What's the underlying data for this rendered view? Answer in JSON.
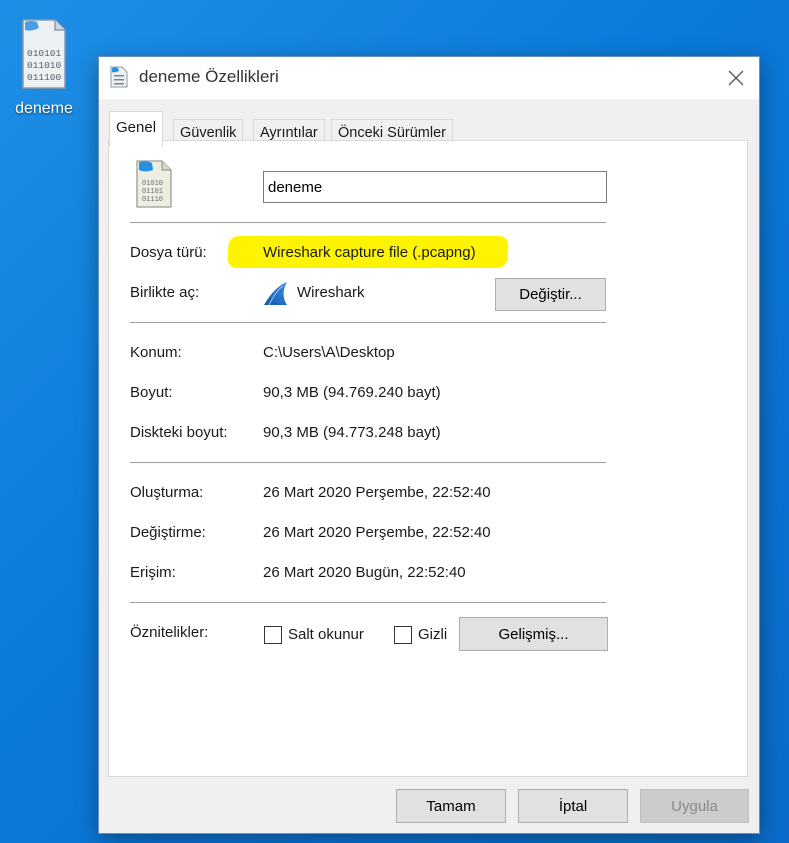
{
  "desktop": {
    "icon_label": "deneme",
    "icon_bits": [
      "010101",
      "011010",
      "011100"
    ]
  },
  "dialog": {
    "title": "deneme Özellikleri",
    "tabs": [
      {
        "label": "Genel",
        "active": true
      },
      {
        "label": "Güvenlik",
        "active": false
      },
      {
        "label": "Ayrıntılar",
        "active": false
      },
      {
        "label": "Önceki Sürümler",
        "active": false
      }
    ],
    "file_icon_bits": [
      "01010",
      "01101",
      "01110"
    ],
    "file_name": "deneme",
    "file_type_label": "Dosya türü:",
    "file_type_value": "Wireshark capture file (.pcapng)",
    "opens_with_label": "Birlikte aç:",
    "opens_with_value": "Wireshark",
    "change_button": "Değiştir...",
    "location_label": "Konum:",
    "location_value": "C:\\Users\\A\\Desktop",
    "size_label": "Boyut:",
    "size_value": "90,3 MB (94.769.240 bayt)",
    "disk_size_label": "Diskteki boyut:",
    "disk_size_value": "90,3 MB (94.773.248 bayt)",
    "created_label": "Oluşturma:",
    "created_value": "26 Mart 2020 Perşembe, 22:52:40",
    "modified_label": "Değiştirme:",
    "modified_value": "26 Mart 2020 Perşembe, 22:52:40",
    "accessed_label": "Erişim:",
    "accessed_value": "26 Mart 2020 Bugün, 22:52:40",
    "attributes_label": "Öznitelikler:",
    "readonly_label": "Salt okunur",
    "readonly_checked": false,
    "hidden_label": "Gizli",
    "hidden_checked": false,
    "advanced_button": "Gelişmiş...",
    "ok_button": "Tamam",
    "cancel_button": "İptal",
    "apply_button": "Uygula",
    "apply_disabled": true,
    "highlight_color": "#fff400"
  }
}
